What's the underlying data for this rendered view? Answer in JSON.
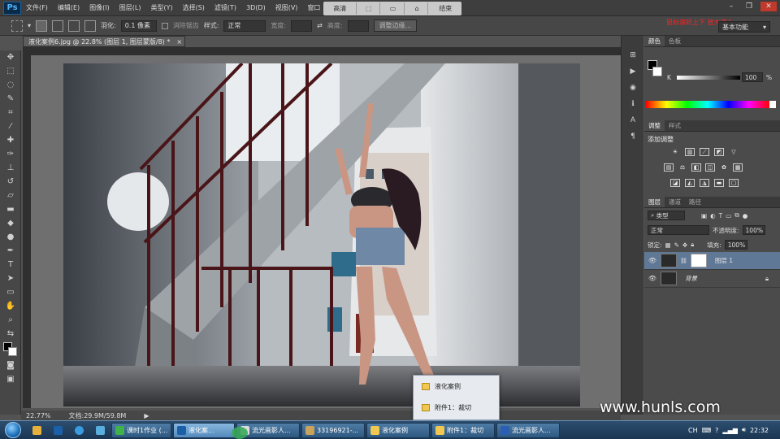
{
  "menubar": {
    "logo": "Ps",
    "items": [
      "文件(F)",
      "编辑(E)",
      "图像(I)",
      "图层(L)",
      "类型(Y)",
      "选择(S)",
      "滤镜(T)",
      "3D(D)",
      "视图(V)",
      "窗口"
    ],
    "view_strip": [
      "高清",
      "结束"
    ]
  },
  "options": {
    "feather_label": "羽化:",
    "feather_value": "0.1 像素",
    "antialias_label": "消除锯齿",
    "style_label": "样式:",
    "style_value": "正常",
    "width_label": "宽度:",
    "height_label": "高度:",
    "refine_button": "调整边缘...",
    "workspace": "基本功能",
    "red_watermark": "鼠标滚轮上下 放大缩小"
  },
  "document": {
    "tab_title": "液化案例6.jpg @ 22.8% (图层 1, 图层蒙版/8) *",
    "zoom": "22.77%",
    "doc_info": "文档:29.9M/59.8M"
  },
  "panels": {
    "color_tabs": [
      "颜色",
      "色板"
    ],
    "k_label": "K",
    "k_value": "100",
    "k_unit": "%",
    "adjust_tabs": [
      "调整",
      "样式"
    ],
    "adjust_title": "添加调整",
    "layers_tabs": [
      "图层",
      "通道",
      "路径"
    ],
    "filter_kind": "类型",
    "blend_mode": "正常",
    "opacity_label": "不透明度:",
    "opacity_value": "100%",
    "lock_label": "锁定:",
    "fill_label": "填充:",
    "fill_value": "100%",
    "layers": [
      {
        "name": "图层 1",
        "selected": true
      },
      {
        "name": "背景",
        "selected": false
      }
    ]
  },
  "popup": {
    "items": [
      "液化案例",
      "附件1：裁切"
    ]
  },
  "watermark": "www.hunls.com",
  "taskbar": {
    "buttons": [
      {
        "label": "课时1作业 (...",
        "icon_color": "#3fb24a",
        "active": false
      },
      {
        "label": "液化案...",
        "icon_color": "#1b5fa8",
        "active": true
      },
      {
        "label": "流光画影人...",
        "icon_color": "#dddddd",
        "active": false
      },
      {
        "label": "33196921-...",
        "icon_color": "#c9a25c",
        "active": false
      },
      {
        "label": "液化案例",
        "icon_color": "#f0c750",
        "active": false
      },
      {
        "label": "附件1：裁切",
        "icon_color": "#f0c750",
        "active": false
      },
      {
        "label": "流光画影人...",
        "icon_color": "#2b5fb3",
        "active": false
      }
    ],
    "lang": "CH",
    "time": "22:32"
  }
}
